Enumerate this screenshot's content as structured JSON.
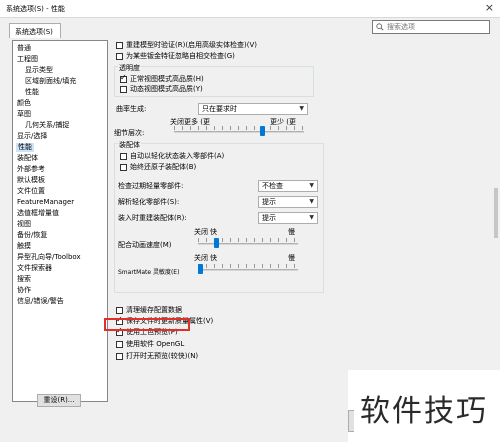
{
  "window": {
    "title": "系统选项(S) - 性能",
    "close": "×"
  },
  "tab": {
    "label": "系统选项(S)"
  },
  "search": {
    "placeholder": "搜索选项"
  },
  "nav": {
    "items": [
      "普通",
      "工程图",
      "显示类型",
      "区域剖面线/填充",
      "性能",
      "颜色",
      "草图",
      "几何关系/捕捉",
      "显示/选择",
      "性能",
      "装配体",
      "外部参考",
      "默认模板",
      "文件位置",
      "FeatureManager",
      "选值框增量值",
      "视图",
      "备份/恢复",
      "触摸",
      "异型孔向导/Toolbox",
      "文件探索器",
      "搜索",
      "协作",
      "信息/错误/警告"
    ],
    "reset": "重设(R)..."
  },
  "performance": {
    "verify_rebuild": "重建模型时验证(R)(启用高级实体检查)(V)",
    "ignore_self_intersect": "为某些钣金特征忽略自相交检查(G)",
    "transparency_group": "透明度",
    "normal_view_hq": "正常视图模式高品质(H)",
    "dynamic_view_hq": "动态视图模式高品质(Y)",
    "curvature_label": "曲率生成:",
    "curvature_value": "只在要求时",
    "lod_label": "细节层次:",
    "lod_off": "关闭更多 (更",
    "lod_less": "更少 (更",
    "assembly_group": "装配体",
    "auto_lightweight": "自动以轻化状态装入零部件(A)",
    "always_resolve": "始终还原子装配体(B)",
    "check_outdated_label": "检查过期轻量零部件:",
    "check_outdated_value": "不检查",
    "resolve_lightweight_label": "解析轻化零部件(S):",
    "resolve_lightweight_value": "提示",
    "rebuild_on_load_label": "装入时重建装配体(R):",
    "rebuild_on_load_value": "提示",
    "animation_speed_label": "配合动画速度(M)",
    "anim_off": "关闭",
    "anim_fast": "快",
    "anim_slow": "慢",
    "smartmate_label": "SmartMate 灵敏度(E)",
    "sm_off": "关闭",
    "sm_fast": "快",
    "sm_slow": "慢",
    "purge_cache": "清理缓存配置数据",
    "save_file_update": "保存文件时更新质量属性(V)",
    "use_shaded_preview": "使用上色预览(P)",
    "use_opengl": "使用软件 OpenGL",
    "no_preview_on_open": "打开时无预览(较快)(N)"
  },
  "checked": {
    "normal_view_hq": true,
    "save_file_update": true,
    "use_shaded_preview": true
  },
  "watermark": {
    "text": "软件技巧"
  },
  "colors": {
    "highlight_box": "#e0302a",
    "accent": "#0078d7"
  }
}
